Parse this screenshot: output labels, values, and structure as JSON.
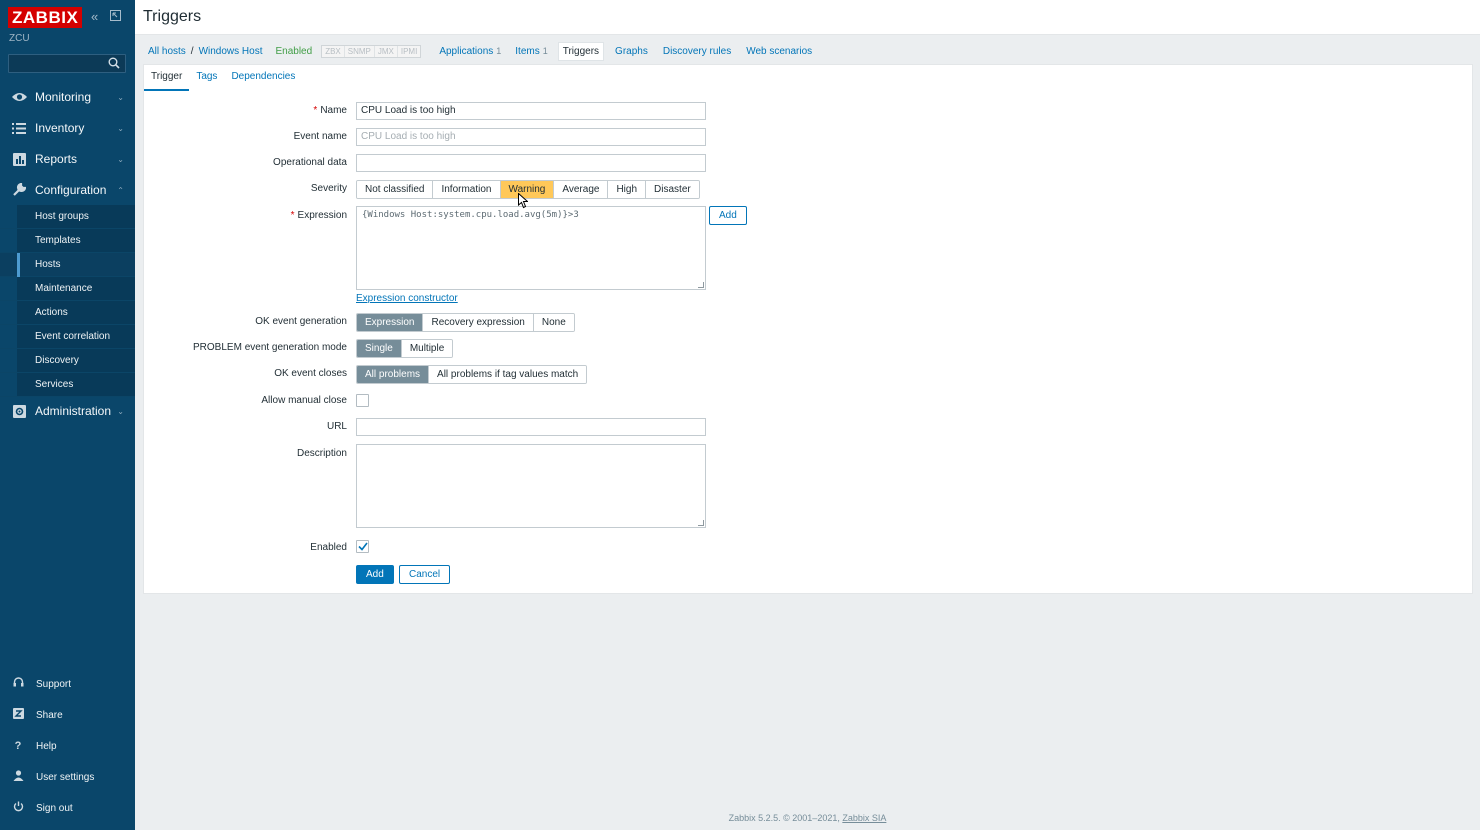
{
  "app": {
    "logo": "ZABBIX",
    "server": "ZCU",
    "collapse_icon": "double-chevron-left-icon",
    "kiosk_icon": "kiosk-mode-icon"
  },
  "sidebar": {
    "search_placeholder": "",
    "menu": [
      {
        "label": "Monitoring",
        "icon": "eye-icon"
      },
      {
        "label": "Inventory",
        "icon": "list-icon"
      },
      {
        "label": "Reports",
        "icon": "bar-chart-icon"
      },
      {
        "label": "Configuration",
        "icon": "wrench-icon"
      },
      {
        "label": "Administration",
        "icon": "gear-icon"
      }
    ],
    "config_submenu": [
      "Host groups",
      "Templates",
      "Hosts",
      "Maintenance",
      "Actions",
      "Event correlation",
      "Discovery",
      "Services"
    ],
    "active_submenu": "Hosts",
    "bottom": [
      {
        "label": "Support",
        "icon": "headset-icon"
      },
      {
        "label": "Share",
        "icon": "share-icon"
      },
      {
        "label": "Help",
        "icon": "question-icon"
      },
      {
        "label": "User settings",
        "icon": "user-icon"
      },
      {
        "label": "Sign out",
        "icon": "power-icon"
      }
    ]
  },
  "header": {
    "title": "Triggers"
  },
  "breadcrumb": {
    "all_hosts": "All hosts",
    "separator": "/",
    "host": "Windows Host",
    "status": "Enabled",
    "badges": [
      "ZBX",
      "SNMP",
      "JMX",
      "IPMI"
    ],
    "tabs": [
      {
        "label": "Applications",
        "count": "1"
      },
      {
        "label": "Items",
        "count": "1"
      },
      {
        "label": "Triggers",
        "count": ""
      },
      {
        "label": "Graphs",
        "count": ""
      },
      {
        "label": "Discovery rules",
        "count": ""
      },
      {
        "label": "Web scenarios",
        "count": ""
      }
    ]
  },
  "form": {
    "tabs": [
      "Trigger",
      "Tags",
      "Dependencies"
    ],
    "required_mark": "*",
    "name_label": "Name",
    "name_value": "CPU Load is too high",
    "event_name_label": "Event name",
    "event_name_placeholder": "CPU Load is too high",
    "opdata_label": "Operational data",
    "opdata_value": "",
    "severity_label": "Severity",
    "severity_options": [
      "Not classified",
      "Information",
      "Warning",
      "Average",
      "High",
      "Disaster"
    ],
    "severity_selected": "Warning",
    "expression_label": "Expression",
    "expression_value": "{Windows Host:system.cpu.load.avg(5m)}>3",
    "expression_add": "Add",
    "expression_constructor": "Expression constructor",
    "ok_event_gen_label": "OK event generation",
    "ok_event_gen_options": [
      "Expression",
      "Recovery expression",
      "None"
    ],
    "problem_mode_label": "PROBLEM event generation mode",
    "problem_mode_options": [
      "Single",
      "Multiple"
    ],
    "ok_closes_label": "OK event closes",
    "ok_closes_options": [
      "All problems",
      "All problems if tag values match"
    ],
    "manual_close_label": "Allow manual close",
    "url_label": "URL",
    "url_value": "",
    "description_label": "Description",
    "description_value": "",
    "enabled_label": "Enabled",
    "add_button": "Add",
    "cancel_button": "Cancel"
  },
  "footer": {
    "text": "Zabbix 5.2.5. © 2001–2021, ",
    "link": "Zabbix SIA"
  },
  "colors": {
    "sidebar": "#0a466a",
    "accent": "#0275b8",
    "warning": "#ffc859",
    "selected": "#768d99",
    "logo": "#d40000",
    "enabled": "#429e47"
  }
}
